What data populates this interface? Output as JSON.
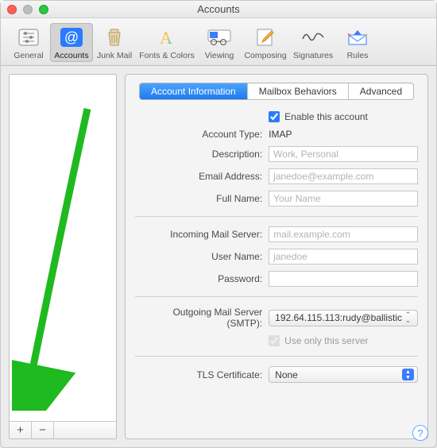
{
  "window": {
    "title": "Accounts"
  },
  "toolbar": {
    "items": [
      {
        "label": "General"
      },
      {
        "label": "Accounts"
      },
      {
        "label": "Junk Mail"
      },
      {
        "label": "Fonts & Colors"
      },
      {
        "label": "Viewing"
      },
      {
        "label": "Composing"
      },
      {
        "label": "Signatures"
      },
      {
        "label": "Rules"
      }
    ],
    "selected_index": 1
  },
  "sidebar": {
    "add": "+",
    "remove": "−"
  },
  "tabs": {
    "items": [
      "Account Information",
      "Mailbox Behaviors",
      "Advanced"
    ],
    "active_index": 0
  },
  "form": {
    "enable_label": "Enable this account",
    "enable_checked": true,
    "account_type": {
      "label": "Account Type:",
      "value": "IMAP"
    },
    "description": {
      "label": "Description:",
      "placeholder": "Work, Personal",
      "value": ""
    },
    "email": {
      "label": "Email Address:",
      "placeholder": "janedoe@example.com",
      "value": ""
    },
    "fullname": {
      "label": "Full Name:",
      "placeholder": "Your Name",
      "value": ""
    },
    "incoming": {
      "label": "Incoming Mail Server:",
      "placeholder": "mail.example.com",
      "value": ""
    },
    "username": {
      "label": "User Name:",
      "placeholder": "janedoe",
      "value": ""
    },
    "password": {
      "label": "Password:",
      "value": ""
    },
    "smtp": {
      "label": "Outgoing Mail Server (SMTP):",
      "value": "192.64.115.113:rudy@ballistic"
    },
    "use_only": {
      "label": "Use only this server",
      "checked": true
    },
    "tls": {
      "label": "TLS Certificate:",
      "value": "None"
    }
  },
  "annotation": {
    "arrow_color": "#1fba1f"
  }
}
